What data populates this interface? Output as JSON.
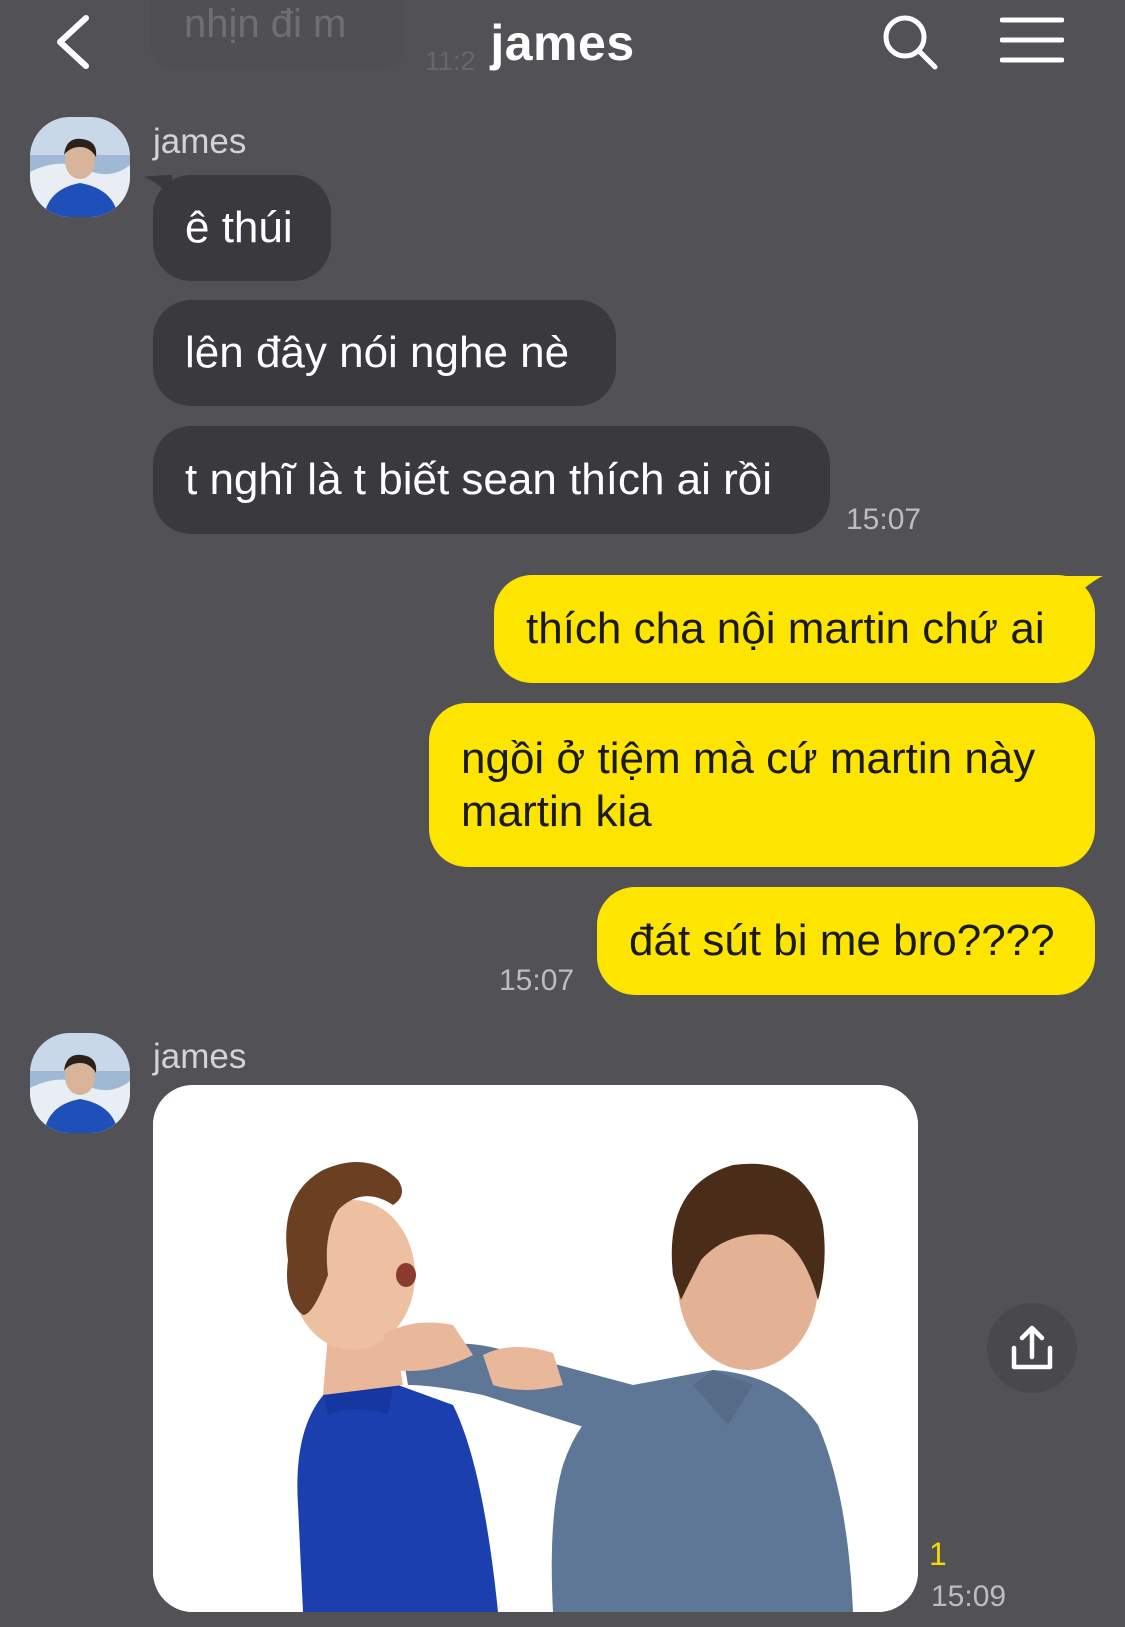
{
  "header": {
    "title": "james",
    "faded_prev_message": "nhịn đi m",
    "faded_prev_time": "11:2"
  },
  "messages": [
    {
      "sender": "james",
      "text": "ê thúi"
    },
    {
      "text": "lên đây nói nghe nè"
    },
    {
      "text": "t nghĩ là t biết sean thích ai rồi",
      "time": "15:07"
    },
    {
      "text": "thích cha nội martin chứ ai"
    },
    {
      "text": "ngồi ở tiệm mà cứ martin này martin kia"
    },
    {
      "text": "đát sút bi me bro????",
      "time": "15:07"
    },
    {
      "sender": "james",
      "type": "image",
      "unread": "1",
      "time": "15:09"
    }
  ],
  "colors": {
    "background": "#525155",
    "incoming_bubble": "#3a393d",
    "outgoing_bubble": "#fde500",
    "unread_count": "#f5d800"
  },
  "icons": [
    "back-icon",
    "search-icon",
    "menu-icon",
    "share-icon"
  ]
}
